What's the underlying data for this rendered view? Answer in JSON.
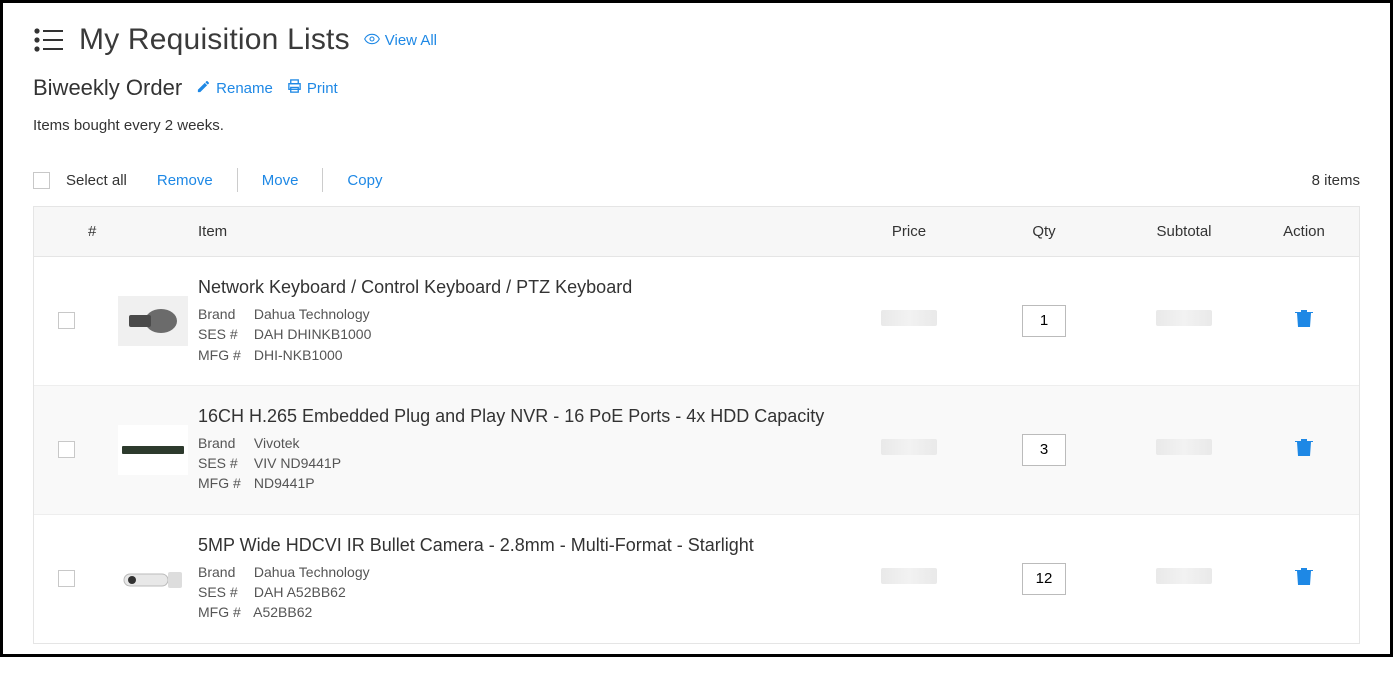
{
  "page": {
    "title": "My Requisition Lists",
    "view_all": "View All"
  },
  "list": {
    "name": "Biweekly Order",
    "rename": "Rename",
    "print": "Print",
    "description": "Items bought every 2 weeks."
  },
  "toolbar": {
    "select_all": "Select all",
    "remove": "Remove",
    "move": "Move",
    "copy": "Copy",
    "count": "8 items"
  },
  "columns": {
    "num": "#",
    "item": "Item",
    "price": "Price",
    "qty": "Qty",
    "subtotal": "Subtotal",
    "action": "Action"
  },
  "labels": {
    "brand": "Brand",
    "ses": "SES #",
    "mfg": "MFG #"
  },
  "rows": [
    {
      "title": "Network Keyboard / Control Keyboard / PTZ Keyboard",
      "brand": "Dahua Technology",
      "ses": "DAH DHINKB1000",
      "mfg": "DHI-NKB1000",
      "qty": "1"
    },
    {
      "title": "16CH H.265 Embedded Plug and Play NVR - 16 PoE Ports - 4x HDD Capacity",
      "brand": "Vivotek",
      "ses": "VIV ND9441P",
      "mfg": "ND9441P",
      "qty": "3"
    },
    {
      "title": "5MP Wide HDCVI IR Bullet Camera - 2.8mm - Multi-Format - Starlight",
      "brand": "Dahua Technology",
      "ses": "DAH A52BB62",
      "mfg": "A52BB62",
      "qty": "12"
    }
  ]
}
